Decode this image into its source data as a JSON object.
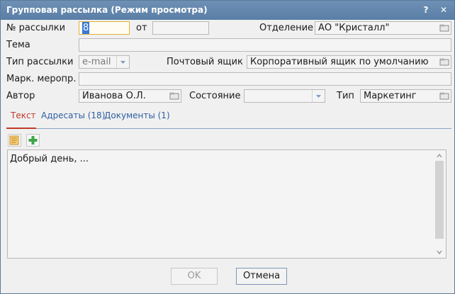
{
  "window": {
    "title": "Групповая рассылка (Режим просмотра)",
    "help": "?",
    "close": "✕"
  },
  "form": {
    "number_label": "№ рассылки",
    "number_value": "8",
    "from_label": "от",
    "from_value": "",
    "department_label": "Отделение",
    "department_value": "АО \"Кристалл\"",
    "subject_label": "Тема",
    "subject_value": "",
    "type_label": "Тип рассылки",
    "type_value": "e-mail",
    "mailbox_label": "Почтовый ящик",
    "mailbox_value": "Корпоративный ящик по умолчанию",
    "event_label": "Марк. меропр.",
    "event_value": "",
    "author_label": "Автор",
    "author_value": "Иванова О.Л.",
    "state_label": "Состояние",
    "state_value": "",
    "kind_label": "Тип",
    "kind_value": "Маркетинг"
  },
  "tabs": [
    {
      "label": "Текст",
      "active": true
    },
    {
      "label": "Адресаты (18)",
      "active": false
    },
    {
      "label": "Документы (1)",
      "active": false
    }
  ],
  "editor": {
    "text": "Добрый день, ..."
  },
  "footer": {
    "ok": "OK",
    "cancel": "Отмена"
  },
  "icons": {
    "folder": "folder-icon",
    "dropdown": "chevron-down-icon",
    "template": "template-icon",
    "add": "plus-icon"
  }
}
